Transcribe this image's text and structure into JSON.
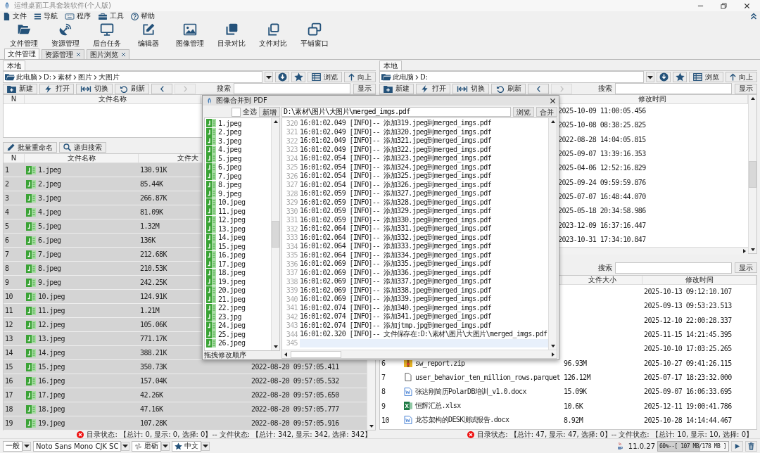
{
  "window": {
    "title": "运维桌面工具套装软件(个人版)"
  },
  "menu": [
    {
      "label": "文件"
    },
    {
      "label": "导航"
    },
    {
      "label": "程序"
    },
    {
      "label": "工具"
    },
    {
      "label": "帮助"
    }
  ],
  "toolbar": [
    {
      "label": "文件管理"
    },
    {
      "label": "资源管理"
    },
    {
      "label": "后台任务"
    },
    {
      "label": "编辑器"
    },
    {
      "label": "图像管理"
    },
    {
      "label": "目录对比"
    },
    {
      "label": "文件对比"
    },
    {
      "label": "平铺窗口"
    }
  ],
  "tabs": [
    {
      "label": "文件管理",
      "selected": true,
      "closable": false
    },
    {
      "label": "资源管理",
      "selected": false,
      "closable": true
    },
    {
      "label": "图片浏览",
      "selected": false,
      "closable": true
    }
  ],
  "panes": [
    {
      "tab": {
        "label": "本地",
        "selected": true
      },
      "path": [
        "此电脑",
        "D:",
        "素材",
        "图片",
        "大图片"
      ],
      "path_buttons": [
        {
          "label": "浏览"
        },
        {
          "label": "向上"
        }
      ],
      "actions": [
        {
          "label": "新建"
        },
        {
          "label": "打开"
        },
        {
          "label": "切换"
        },
        {
          "label": "刷新"
        }
      ],
      "nav_buttons": [
        {
          "kind": "back",
          "disabled": false
        },
        {
          "kind": "forward",
          "disabled": true
        }
      ],
      "search": {
        "label": "搜索",
        "button": "显示"
      },
      "dir_table": {
        "columns": [
          "N",
          "文件名称"
        ]
      },
      "file_bar": {
        "tools": [
          {
            "label": "批量重命名"
          },
          {
            "label": "递归搜索"
          }
        ]
      },
      "file_table": {
        "columns": [
          "N",
          "文件名称",
          "文件大"
        ],
        "rows": [
          {
            "n": "1",
            "kind": "image",
            "name": "1.jpeg",
            "size": "130.91K",
            "selected": true
          },
          {
            "n": "2",
            "kind": "image",
            "name": "2.jpeg",
            "size": "85.44K",
            "selected": true
          },
          {
            "n": "3",
            "kind": "image",
            "name": "3.jpeg",
            "size": "266.87K",
            "selected": true
          },
          {
            "n": "4",
            "kind": "image",
            "name": "4.jpeg",
            "size": "81.09K",
            "selected": true
          },
          {
            "n": "5",
            "kind": "image",
            "name": "5.jpeg",
            "size": "1.32M",
            "selected": true
          },
          {
            "n": "6",
            "kind": "image",
            "name": "6.jpeg",
            "size": "136K",
            "selected": true
          },
          {
            "n": "7",
            "kind": "image",
            "name": "7.jpeg",
            "size": "212.68K",
            "selected": true
          },
          {
            "n": "8",
            "kind": "image",
            "name": "8.jpeg",
            "size": "210.53K",
            "selected": true
          },
          {
            "n": "9",
            "kind": "image",
            "name": "9.jpeg",
            "size": "242.25K",
            "selected": true
          },
          {
            "n": "10",
            "kind": "image",
            "name": "10.jpeg",
            "size": "124.91K",
            "selected": true
          },
          {
            "n": "11",
            "kind": "image",
            "name": "11.jpeg",
            "size": "1.21M",
            "selected": true
          },
          {
            "n": "12",
            "kind": "image",
            "name": "12.jpeg",
            "size": "105.06K",
            "selected": true
          },
          {
            "n": "13",
            "kind": "image",
            "name": "13.jpeg",
            "size": "771.17K",
            "selected": true
          },
          {
            "n": "14",
            "kind": "image",
            "name": "14.jpeg",
            "size": "388.21K",
            "selected": true
          },
          {
            "n": "15",
            "kind": "image",
            "name": "15.jpeg",
            "size": "350.73K",
            "modified": "2022-08-20 09:57:05.411",
            "selected": true
          },
          {
            "n": "16",
            "kind": "image",
            "name": "16.jpeg",
            "size": "157.04K",
            "modified": "2022-08-20 09:57:05.532",
            "selected": true
          },
          {
            "n": "17",
            "kind": "image",
            "name": "17.jpeg",
            "size": "42.26K",
            "modified": "2022-08-20 09:57:05.650",
            "selected": true
          },
          {
            "n": "18",
            "kind": "image",
            "name": "18.jpeg",
            "size": "47.16K",
            "modified": "2022-08-20 09:57:05.777",
            "selected": true
          },
          {
            "n": "19",
            "kind": "image",
            "name": "19.jpeg",
            "size": "107.28K",
            "modified": "2022-08-20 09:57:05.916",
            "selected": true
          }
        ]
      },
      "status": "目录状态: 【总计: 0, 显示: 0, 选择: 0】-- 文件状态: 【总计: 342, 显示: 342, 选择: 342】"
    },
    {
      "tab": {
        "label": "本地",
        "selected": true
      },
      "path": [
        "此电脑",
        "D:"
      ],
      "path_buttons": [
        {
          "label": "浏览"
        },
        {
          "label": "向上"
        }
      ],
      "actions": [
        {
          "label": "新建"
        },
        {
          "label": "打开"
        },
        {
          "label": "切换"
        },
        {
          "label": "刷新"
        }
      ],
      "nav_buttons": [
        {
          "kind": "back",
          "disabled": false
        },
        {
          "kind": "forward",
          "disabled": true
        }
      ],
      "search": {
        "label": "搜索",
        "button": "显示"
      },
      "dir_table": {
        "columns": [
          "修改时间"
        ],
        "rows": [
          {
            "modified": "2025-10-09 11:00:05.456",
            "selected": false
          },
          {
            "modified": "2025-10-08 08:38:25.825",
            "selected": false
          },
          {
            "modified": "2022-08-28 14:04:05.815",
            "selected": false
          },
          {
            "modified": "2025-09-07 13:39:16.353",
            "selected": false
          },
          {
            "modified": "2025-04-06 12:52:16.829",
            "selected": false
          },
          {
            "modified": "2025-09-24 09:59:59.876",
            "selected": false
          },
          {
            "modified": "2025-07-07 16:48:44.070",
            "selected": false
          },
          {
            "modified": "2025-05-18 20:34:58.986",
            "selected": false
          },
          {
            "modified": "2023-12-09 16:37:16.447",
            "selected": false
          },
          {
            "modified": "2023-10-31 17:34:10.847",
            "selected": false
          }
        ]
      },
      "file_bar": {
        "search": {
          "label": "搜索",
          "button": "显示"
        }
      },
      "file_table": {
        "columns": [
          "文件大小",
          "修改时间"
        ],
        "rows": [
          {
            "modified": "2025-10-13 09:12:10.107",
            "selected": false
          },
          {
            "modified": "2025-09-13 09:53:23.513",
            "selected": false
          },
          {
            "modified": "2025-12-10 22:00:28.337",
            "selected": false
          },
          {
            "modified": "2025-11-15 14:21:45.395",
            "selected": false
          },
          {
            "modified": "2025-10-10 17:03:25.265",
            "selected": false
          },
          {
            "n": "6",
            "kind": "archive",
            "name": "sw_report.zip",
            "size": "96.93M",
            "modified": "2025-10-27 09:41:26.115",
            "selected": false
          },
          {
            "n": "7",
            "kind": "file",
            "name": "user_behavior_ten_million_rows.parquet",
            "size": "126.12M",
            "modified": "2025-07-17 18:23:32.000",
            "selected": false
          },
          {
            "n": "8",
            "kind": "word",
            "name": "张达刚简历PolarDB培训_v1.0.docx",
            "size": "15.09K",
            "modified": "2025-09-07 16:06:33.695",
            "selected": false
          },
          {
            "n": "9",
            "kind": "excel",
            "name": "恒辉汇总.xlsx",
            "size": "10.6K",
            "modified": "2025-12-11 19:00:41.786",
            "selected": false
          },
          {
            "n": "10",
            "kind": "word",
            "name": "龙芯架构的DESK测试报告.docx",
            "size": "8.92M",
            "modified": "2025-10-28 14:14:44.467",
            "selected": false
          }
        ]
      },
      "status": "目录状态: 【总计: 47, 显示: 47, 选择: 0】-- 文件状态: 【总计: 10, 显示: 10, 选择: 0】"
    }
  ],
  "dialog": {
    "title": "图像合并到 PDF",
    "select_all": {
      "label": "全选",
      "checked": false
    },
    "add_button": "新增",
    "items": [
      {
        "name": "1.jpeg"
      },
      {
        "name": "2.jpeg"
      },
      {
        "name": "3.jpeg"
      },
      {
        "name": "4.jpeg"
      },
      {
        "name": "5.jpeg"
      },
      {
        "name": "6.jpeg"
      },
      {
        "name": "7.jpeg"
      },
      {
        "name": "8.jpeg"
      },
      {
        "name": "9.jpeg"
      },
      {
        "name": "10.jpeg"
      },
      {
        "name": "11.jpeg"
      },
      {
        "name": "12.jpeg"
      },
      {
        "name": "13.jpeg"
      },
      {
        "name": "14.jpeg"
      },
      {
        "name": "15.jpeg"
      },
      {
        "name": "16.jpeg"
      },
      {
        "name": "17.jpeg"
      },
      {
        "name": "18.jpeg"
      },
      {
        "name": "19.jpeg"
      },
      {
        "name": "20.jpeg"
      },
      {
        "name": "21.jpeg"
      },
      {
        "name": "22.jpeg"
      },
      {
        "name": "23.jpg"
      },
      {
        "name": "24.jpeg"
      },
      {
        "name": "25.jpeg"
      },
      {
        "name": "26.jpeg"
      }
    ],
    "hint": "拖拽修改顺序",
    "output_path": "D:\\素材\\图片\\大图片\\merged_imgs.pdf",
    "buttons": [
      {
        "label": "浏览"
      },
      {
        "label": "合并"
      }
    ],
    "log": [
      {
        "number": "320",
        "text": "16:01:02.049 [INFO]-- 添加319.jpeg到merged_imgs.pdf",
        "current": false
      },
      {
        "number": "321",
        "text": "16:01:02.049 [INFO]-- 添加320.jpeg到merged_imgs.pdf",
        "current": false
      },
      {
        "number": "322",
        "text": "16:01:02.049 [INFO]-- 添加321.jpeg到merged_imgs.pdf",
        "current": false
      },
      {
        "number": "323",
        "text": "16:01:02.049 [INFO]-- 添加322.jpeg到merged_imgs.pdf",
        "current": false
      },
      {
        "number": "324",
        "text": "16:01:02.054 [INFO]-- 添加323.jpeg到merged_imgs.pdf",
        "current": false
      },
      {
        "number": "325",
        "text": "16:01:02.054 [INFO]-- 添加324.jpeg到merged_imgs.pdf",
        "current": false
      },
      {
        "number": "326",
        "text": "16:01:02.054 [INFO]-- 添加325.jpeg到merged_imgs.pdf",
        "current": false
      },
      {
        "number": "327",
        "text": "16:01:02.054 [INFO]-- 添加326.jpeg到merged_imgs.pdf",
        "current": false
      },
      {
        "number": "328",
        "text": "16:01:02.059 [INFO]-- 添加327.jpeg到merged_imgs.pdf",
        "current": false
      },
      {
        "number": "329",
        "text": "16:01:02.059 [INFO]-- 添加328.jpeg到merged_imgs.pdf",
        "current": false
      },
      {
        "number": "330",
        "text": "16:01:02.059 [INFO]-- 添加329.jpeg到merged_imgs.pdf",
        "current": false
      },
      {
        "number": "331",
        "text": "16:01:02.059 [INFO]-- 添加330.jpeg到merged_imgs.pdf",
        "current": false
      },
      {
        "number": "332",
        "text": "16:01:02.064 [INFO]-- 添加331.jpeg到merged_imgs.pdf",
        "current": false
      },
      {
        "number": "333",
        "text": "16:01:02.064 [INFO]-- 添加332.jpeg到merged_imgs.pdf",
        "current": false
      },
      {
        "number": "334",
        "text": "16:01:02.064 [INFO]-- 添加333.jpeg到merged_imgs.pdf",
        "current": false
      },
      {
        "number": "335",
        "text": "16:01:02.064 [INFO]-- 添加334.jpeg到merged_imgs.pdf",
        "current": false
      },
      {
        "number": "336",
        "text": "16:01:02.069 [INFO]-- 添加335.jpeg到merged_imgs.pdf",
        "current": false
      },
      {
        "number": "337",
        "text": "16:01:02.069 [INFO]-- 添加336.jpeg到merged_imgs.pdf",
        "current": false
      },
      {
        "number": "338",
        "text": "16:01:02.069 [INFO]-- 添加337.jpeg到merged_imgs.pdf",
        "current": false
      },
      {
        "number": "339",
        "text": "16:01:02.069 [INFO]-- 添加338.jpeg到merged_imgs.pdf",
        "current": false
      },
      {
        "number": "340",
        "text": "16:01:02.069 [INFO]-- 添加339.jpeg到merged_imgs.pdf",
        "current": false
      },
      {
        "number": "341",
        "text": "16:01:02.074 [INFO]-- 添加340.jpeg到merged_imgs.pdf",
        "current": false
      },
      {
        "number": "342",
        "text": "16:01:02.074 [INFO]-- 添加341.jpeg到merged_imgs.pdf",
        "current": false
      },
      {
        "number": "343",
        "text": "16:01:02.074 [INFO]-- 添加jtmp.jpg到merged_imgs.pdf",
        "current": false
      },
      {
        "number": "344",
        "text": "16:01:02.320 [INFO]-- 文件保存在:D:\\素材\\图片\\大图片\\merged_imgs.pdf",
        "current": false
      },
      {
        "number": "345",
        "current": true
      }
    ]
  },
  "status_bar": {
    "selects": [
      {
        "value": "一般"
      },
      {
        "value": "Noto Sans Mono CJK SC"
      },
      {
        "value": "磨砺"
      },
      {
        "value": "中文"
      }
    ],
    "version": "11.0.27",
    "memory": {
      "reading": "60%--[ 107 MB/178 MB ]",
      "level": 0.6
    }
  }
}
